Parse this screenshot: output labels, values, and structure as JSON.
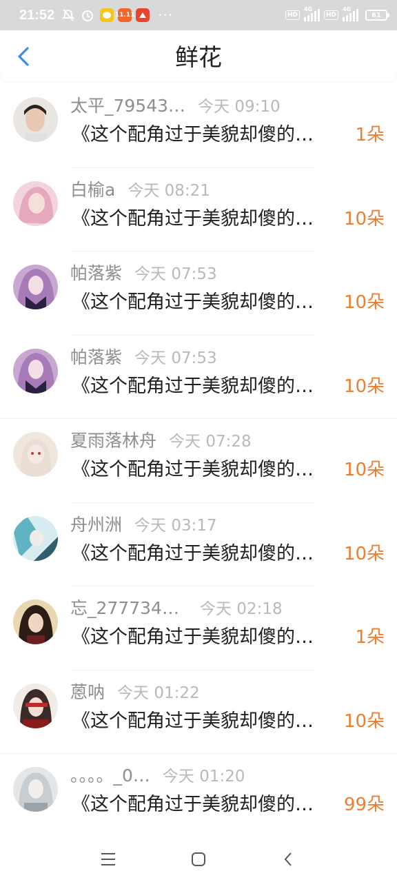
{
  "status_bar": {
    "time": "21:52",
    "app_badges": [
      {
        "icon": "messenger-app-icon",
        "color": "#f5c518",
        "text": ""
      },
      {
        "icon": "taobao-app-icon",
        "color": "#f2652b",
        "text": "11.11"
      },
      {
        "icon": "pinduoduo-app-icon",
        "color": "#e8432e",
        "text": ""
      }
    ],
    "more": "···",
    "hd1": "HD",
    "net1": "4G",
    "hd2": "HD",
    "net2": "4G",
    "battery": "61"
  },
  "header": {
    "title": "鲜花",
    "back_icon": "chevron-left-icon",
    "accent_color": "#3a8ee6"
  },
  "items": [
    {
      "username": "太平_79543…",
      "time": "今天 09:10",
      "message": "《这个配角过于美貌却傻的…",
      "count": "1朵"
    },
    {
      "username": "白榆a",
      "time": "今天 08:21",
      "message": "《这个配角过于美貌却傻的…",
      "count": "10朵"
    },
    {
      "username": "帕落紫",
      "time": "今天 07:53",
      "message": "《这个配角过于美貌却傻的…",
      "count": "10朵"
    },
    {
      "username": "帕落紫",
      "time": "今天 07:53",
      "message": "《这个配角过于美貌却傻的…",
      "count": "10朵"
    },
    {
      "username": "夏雨落林舟",
      "time": "今天 07:28",
      "message": "《这个配角过于美貌却傻的…",
      "count": "10朵"
    },
    {
      "username": "舟州洲",
      "time": "今天 03:17",
      "message": "《这个配角过于美貌却傻的…",
      "count": "10朵"
    },
    {
      "username": "忘_2777349…",
      "time": "今天 02:18",
      "message": "《这个配角过于美貌却傻的…",
      "count": "1朵"
    },
    {
      "username": "蒽呐",
      "time": "今天 01:22",
      "message": "《这个配角过于美貌却傻的…",
      "count": "10朵"
    },
    {
      "username": "。。。。_0…",
      "time": "今天 01:20",
      "message": "《这个配角过于美貌却傻的…",
      "count": "99朵"
    }
  ],
  "colors": {
    "count": "#ee7d2c",
    "username": "#8e8e8e",
    "timestamp": "#b9b9b9"
  },
  "nav": {
    "menu_icon": "menu-icon",
    "home_icon": "home-icon",
    "back_icon": "back-icon"
  }
}
